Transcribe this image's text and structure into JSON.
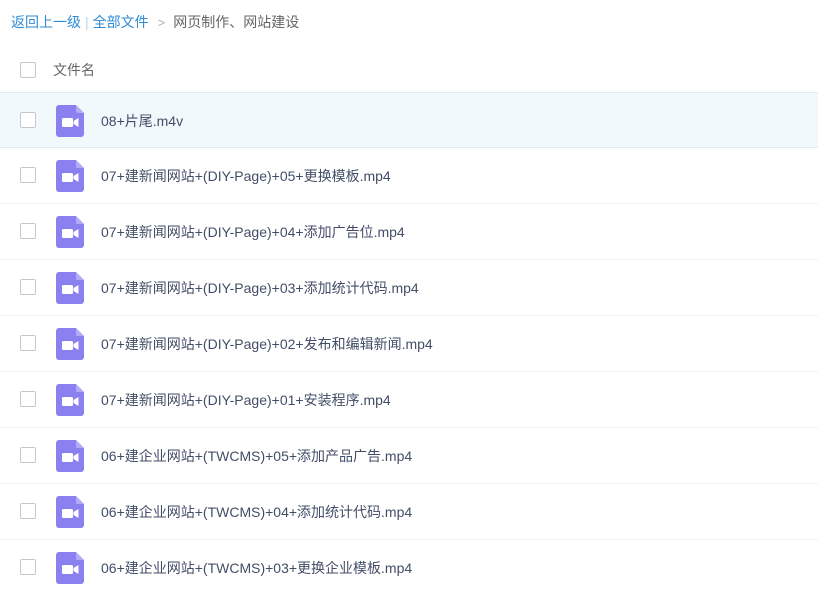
{
  "breadcrumb": {
    "back_label": "返回上一级",
    "separator": "|",
    "all_files_label": "全部文件",
    "arrow": ">",
    "current_folder": "网页制作、网站建设"
  },
  "list_header": {
    "name_column_label": "文件名"
  },
  "colors": {
    "link": "#2e8bd6",
    "video_icon": "#8b80f0",
    "selected_row": "#f1f9fd"
  },
  "files": [
    {
      "name": "08+片尾.m4v",
      "icon": "video-file-icon",
      "selected": true
    },
    {
      "name": "07+建新闻网站+(DIY-Page)+05+更换模板.mp4",
      "icon": "video-file-icon",
      "selected": false
    },
    {
      "name": "07+建新闻网站+(DIY-Page)+04+添加广告位.mp4",
      "icon": "video-file-icon",
      "selected": false
    },
    {
      "name": "07+建新闻网站+(DIY-Page)+03+添加统计代码.mp4",
      "icon": "video-file-icon",
      "selected": false
    },
    {
      "name": "07+建新闻网站+(DIY-Page)+02+发布和编辑新闻.mp4",
      "icon": "video-file-icon",
      "selected": false
    },
    {
      "name": "07+建新闻网站+(DIY-Page)+01+安装程序.mp4",
      "icon": "video-file-icon",
      "selected": false
    },
    {
      "name": "06+建企业网站+(TWCMS)+05+添加产品广告.mp4",
      "icon": "video-file-icon",
      "selected": false
    },
    {
      "name": "06+建企业网站+(TWCMS)+04+添加统计代码.mp4",
      "icon": "video-file-icon",
      "selected": false
    },
    {
      "name": "06+建企业网站+(TWCMS)+03+更换企业模板.mp4",
      "icon": "video-file-icon",
      "selected": false
    }
  ]
}
